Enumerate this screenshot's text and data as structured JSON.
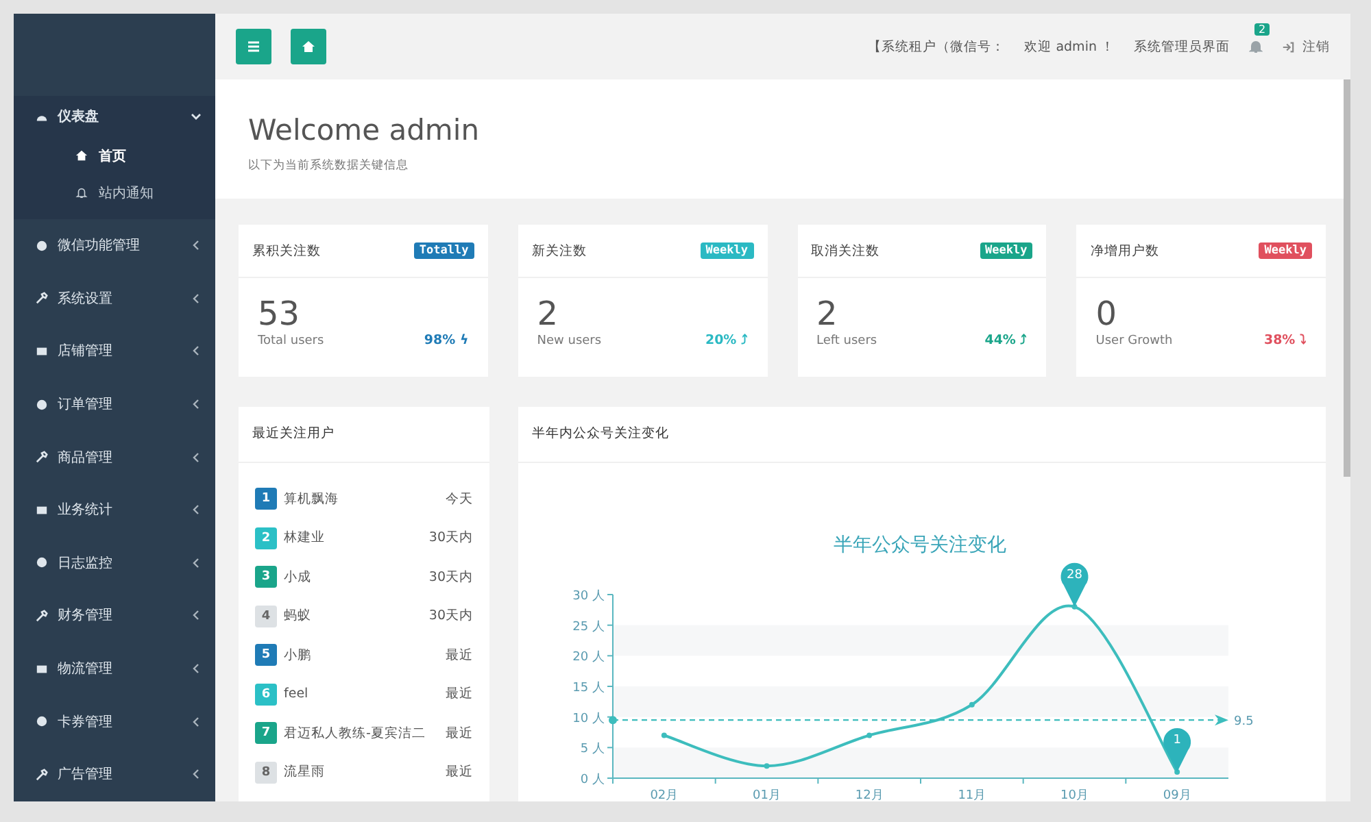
{
  "sidebar": {
    "items": [
      {
        "label": "仪表盘",
        "expanded": true,
        "children": [
          {
            "label": "首页",
            "selected": true
          },
          {
            "label": "站内通知",
            "selected": false
          }
        ]
      },
      {
        "label": "微信功能管理",
        "expanded": false
      },
      {
        "label": "系统设置",
        "expanded": false
      },
      {
        "label": "店铺管理",
        "expanded": false
      },
      {
        "label": "订单管理",
        "expanded": false
      },
      {
        "label": "商品管理",
        "expanded": false
      },
      {
        "label": "业务统计",
        "expanded": false
      },
      {
        "label": "日志监控",
        "expanded": false
      },
      {
        "label": "财务管理",
        "expanded": false
      },
      {
        "label": "物流管理",
        "expanded": false
      },
      {
        "label": "卡券管理",
        "expanded": false
      },
      {
        "label": "广告管理",
        "expanded": false
      }
    ]
  },
  "topbar": {
    "tenant": "【系统租户（微信号：",
    "welcome": "欢迎 admin ！",
    "role": "系统管理员界面",
    "notifications": "2",
    "logout": "注销"
  },
  "header": {
    "title": "Welcome admin",
    "subtitle": "以下为当前系统数据关键信息"
  },
  "stats": [
    {
      "title": "累积关注数",
      "badge": "Totally",
      "color": "#1f7bb6",
      "value": "53",
      "caption": "Total users",
      "percent": "98% ϟ"
    },
    {
      "title": "新关注数",
      "badge": "Weekly",
      "color": "#2bb9c3",
      "value": "2",
      "caption": "New users",
      "percent": "20% ⤴"
    },
    {
      "title": "取消关注数",
      "badge": "Weekly",
      "color": "#1aa58a",
      "value": "2",
      "caption": "Left users",
      "percent": "44% ⤴"
    },
    {
      "title": "净增用户数",
      "badge": "Weekly",
      "color": "#e0505e",
      "value": "0",
      "caption": "User Growth",
      "percent": "38% ⤵"
    }
  ],
  "recent": {
    "title": "最近关注用户",
    "rows": [
      {
        "rank": "1",
        "color": "#1f7bb6",
        "name": "算机飘海",
        "time": "今天"
      },
      {
        "rank": "2",
        "color": "#2bc0c6",
        "name": "林建业",
        "time": "30天内"
      },
      {
        "rank": "3",
        "color": "#1aa58a",
        "name": "小成",
        "time": "30天内"
      },
      {
        "rank": "4",
        "color": "#dde1e4",
        "name": "蚂蚁",
        "time": "30天内"
      },
      {
        "rank": "5",
        "color": "#1f7bb6",
        "name": "小鹏",
        "time": "最近"
      },
      {
        "rank": "6",
        "color": "#2bc0c6",
        "name": "feel",
        "time": "最近"
      },
      {
        "rank": "7",
        "color": "#1aa58a",
        "name": "君迈私人教练-夏宾洁二",
        "time": "最近"
      },
      {
        "rank": "8",
        "color": "#dde1e4",
        "name": "流星雨",
        "time": "最近"
      }
    ]
  },
  "trend_panel": {
    "title": "半年内公众号关注变化",
    "chart_data": {
      "type": "line",
      "title": "半年公众号关注变化",
      "categories": [
        "02月",
        "01月",
        "12月",
        "11月",
        "10月",
        "09月"
      ],
      "series": [
        {
          "color": "#3dbdbd",
          "marker": "circle",
          "values": [
            7,
            2,
            7,
            12,
            28,
            1
          ]
        }
      ],
      "ylim": [
        0,
        30
      ],
      "yticks": [
        {
          "value": 0,
          "label": "0 人"
        },
        {
          "value": 5,
          "label": "5 人"
        },
        {
          "value": 10,
          "label": "10 人"
        },
        {
          "value": 15,
          "label": "15 人"
        },
        {
          "value": 20,
          "label": "20 人"
        },
        {
          "value": 25,
          "label": "25 人"
        },
        {
          "value": 30,
          "label": "30 人"
        }
      ],
      "ref_lines": [
        {
          "axis": "y",
          "value": 9.5,
          "label": "9.5"
        }
      ],
      "annotations": [
        {
          "text": "28",
          "x": "10月",
          "y": 28
        },
        {
          "text": "1",
          "x": "09月",
          "y": 1
        }
      ]
    }
  }
}
